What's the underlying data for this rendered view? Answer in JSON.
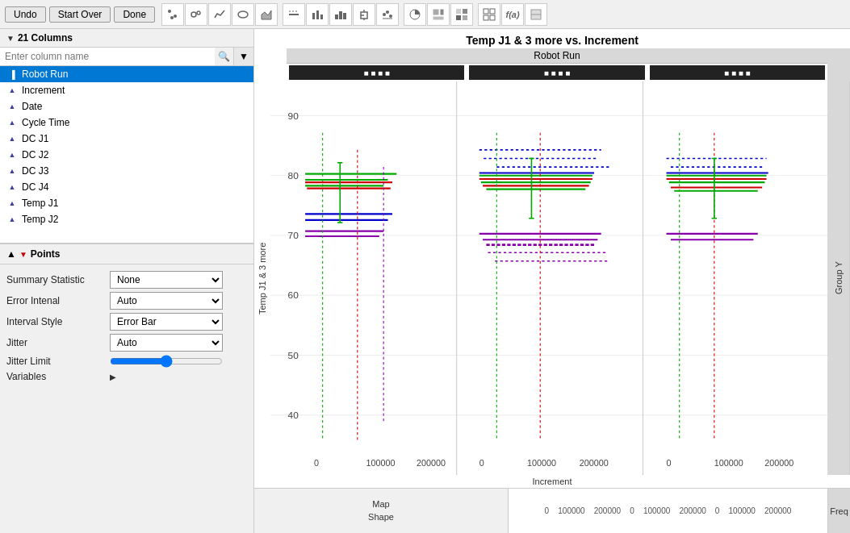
{
  "toolbar": {
    "undo_label": "Undo",
    "start_over_label": "Start Over",
    "done_label": "Done"
  },
  "left_panel": {
    "columns_header": "21 Columns",
    "search_placeholder": "Enter column name",
    "columns": [
      {
        "name": "Robot Run",
        "icon": "bar",
        "selected": true
      },
      {
        "name": "Increment",
        "icon": "tri",
        "selected": false
      },
      {
        "name": "Date",
        "icon": "tri",
        "selected": false
      },
      {
        "name": "Cycle Time",
        "icon": "tri",
        "selected": false
      },
      {
        "name": "DC J1",
        "icon": "tri",
        "selected": false
      },
      {
        "name": "DC J2",
        "icon": "tri",
        "selected": false
      },
      {
        "name": "DC J3",
        "icon": "tri",
        "selected": false
      },
      {
        "name": "DC J4",
        "icon": "tri",
        "selected": false
      },
      {
        "name": "Temp J1",
        "icon": "tri",
        "selected": false
      },
      {
        "name": "Temp J2",
        "icon": "tri",
        "selected": false
      }
    ]
  },
  "points_section": {
    "header": "Points",
    "summary_statistic_label": "Summary Statistic",
    "summary_statistic_value": "None",
    "error_interval_label": "Error Intenal",
    "error_interval_value": "Auto",
    "interval_style_label": "Interval Style",
    "interval_style_value": "Error Bar",
    "jitter_label": "Jitter",
    "jitter_value": "Auto",
    "jitter_limit_label": "Jitter Limit",
    "variables_label": "Variables"
  },
  "chart": {
    "title": "Temp J1 & 3 more vs. Increment",
    "robot_run_label": "Robot Run",
    "y_axis_label": "Temp J1 & 3 more",
    "x_axis_label": "Increment",
    "group_y_label": "Group Y",
    "y_ticks": [
      "90",
      "80",
      "70",
      "60",
      "50",
      "40"
    ],
    "x_ticks_per_facet": [
      "0",
      "100000",
      "200000"
    ],
    "facets": [
      {
        "label": "■■■■■■■■■■■■"
      },
      {
        "label": "■■■■■■■■■■■■"
      },
      {
        "label": "■■■■■■■■■■■■"
      }
    ]
  },
  "bottom": {
    "map_shape_label": "Map\nShape",
    "x_ticks": [
      "0",
      "100000",
      "200000",
      "0",
      "100000",
      "200000",
      "0",
      "100000",
      "200000"
    ],
    "freq_label": "Freq"
  }
}
